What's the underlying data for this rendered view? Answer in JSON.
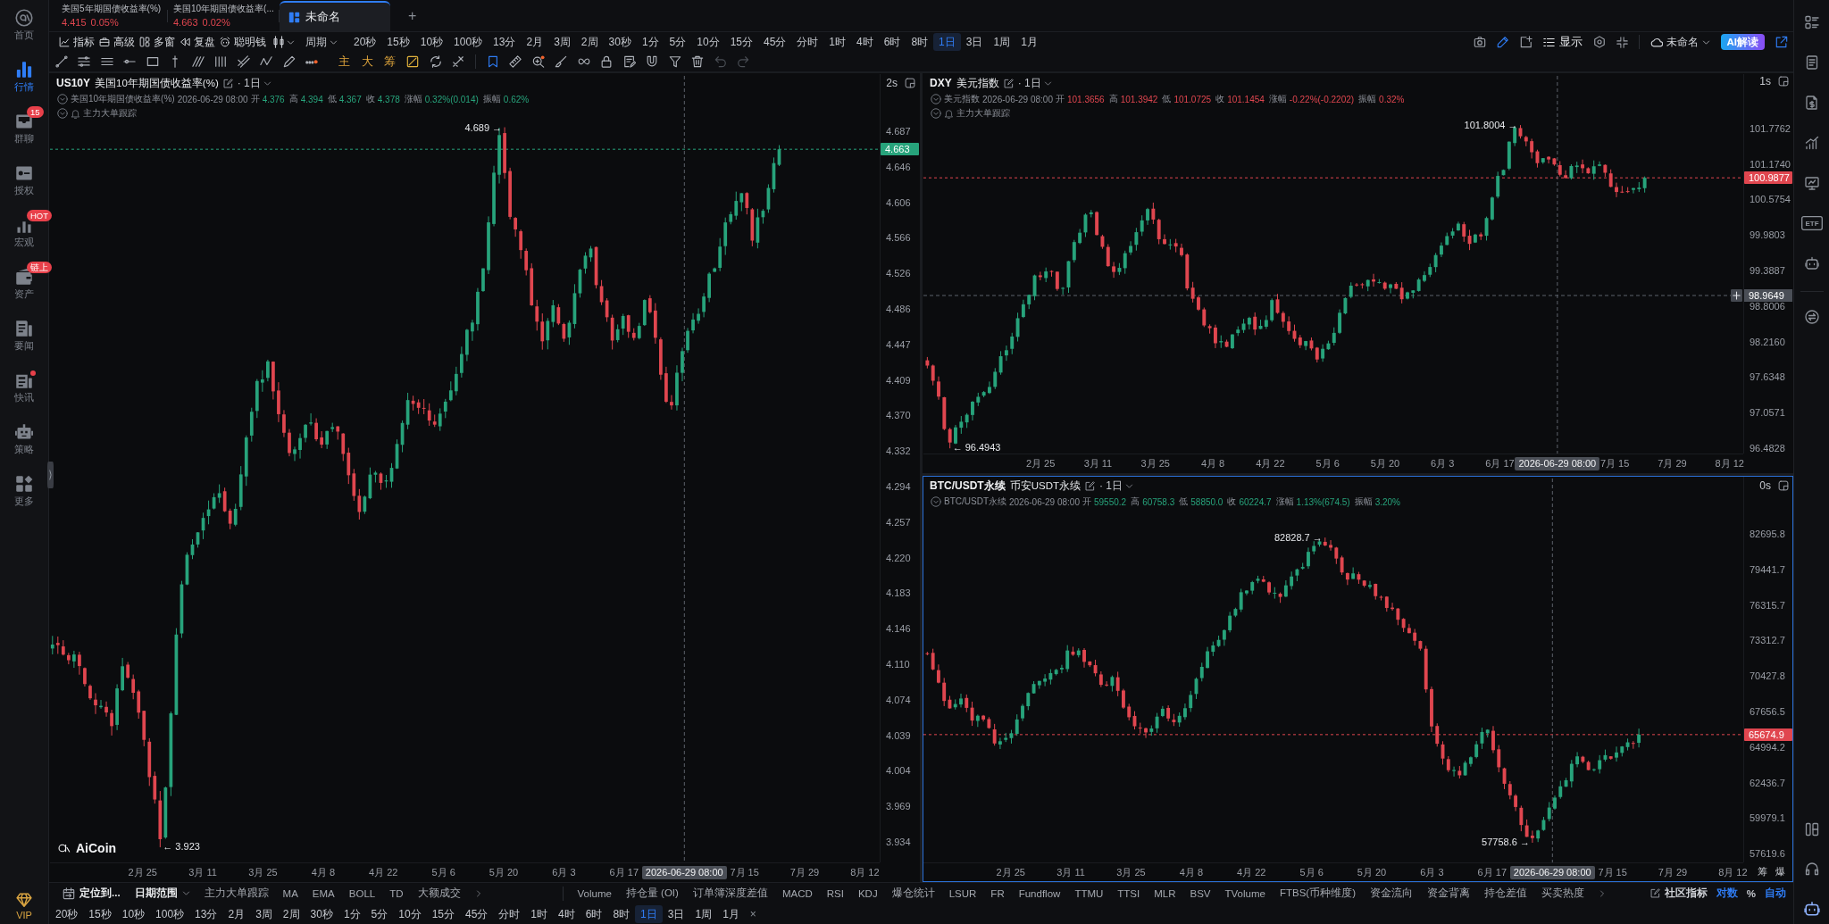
{
  "sidebar": {
    "items": [
      {
        "label": "首页",
        "selected": false,
        "dot": false
      },
      {
        "label": "行情",
        "selected": true,
        "dot": false
      },
      {
        "label": "群聊",
        "selected": false,
        "dot": false,
        "badge": "15"
      },
      {
        "label": "授权",
        "selected": false,
        "dot": false
      },
      {
        "label": "宏观",
        "selected": false,
        "dot": false,
        "badge": "HOT"
      },
      {
        "label": "资产",
        "selected": false,
        "dot": false,
        "badge": "链上"
      },
      {
        "label": "要闻",
        "selected": false,
        "dot": false
      },
      {
        "label": "快讯",
        "selected": false,
        "dot": true
      },
      {
        "label": "策略",
        "selected": false,
        "dot": false
      },
      {
        "label": "更多",
        "selected": false,
        "dot": false
      }
    ],
    "vip": "VIP"
  },
  "tabs": {
    "items": [
      {
        "kind": "quote",
        "title": "美国5年期国债收益率(%)",
        "price": "4.415",
        "change": "0.05%",
        "selected": false
      },
      {
        "kind": "quote",
        "title": "美国10年期国债收益率(...",
        "price": "4.663",
        "change": "0.02%",
        "selected": false
      },
      {
        "kind": "layout",
        "title": "未命名",
        "selected": true
      }
    ],
    "add": "+"
  },
  "toolbar": {
    "tools": [
      "指标",
      "高级",
      "多窗",
      "复盘",
      "聪明钱"
    ],
    "period": "周期",
    "intervals": [
      {
        "label": "20秒",
        "selected": false
      },
      {
        "label": "15秒",
        "selected": false
      },
      {
        "label": "10秒",
        "selected": false
      },
      {
        "label": "100秒",
        "selected": false
      },
      {
        "label": "13分",
        "selected": false
      },
      {
        "label": "2月",
        "selected": false
      },
      {
        "label": "3周",
        "selected": false
      },
      {
        "label": "2周",
        "selected": false
      },
      {
        "label": "30秒",
        "selected": false
      },
      {
        "label": "1分",
        "selected": false
      },
      {
        "label": "5分",
        "selected": false
      },
      {
        "label": "10分",
        "selected": false
      },
      {
        "label": "15分",
        "selected": false
      },
      {
        "label": "45分",
        "selected": false
      },
      {
        "label": "分时",
        "selected": false
      },
      {
        "label": "1时",
        "selected": false
      },
      {
        "label": "4时",
        "selected": false
      },
      {
        "label": "6时",
        "selected": false
      },
      {
        "label": "8时",
        "selected": false
      },
      {
        "label": "1日",
        "selected": true
      },
      {
        "label": "3日",
        "selected": false
      },
      {
        "label": "1周",
        "selected": false
      },
      {
        "label": "1月",
        "selected": false
      }
    ],
    "display": "显示",
    "layout": "未命名",
    "ai": "AI解读"
  },
  "drawing_tools": {
    "markers": [
      "主",
      "大",
      "筹"
    ]
  },
  "charts": [
    {
      "symbol": "US10Y",
      "name": "美国10年期国债收益率(%)",
      "interval": "· 1日",
      "latency": "2s",
      "selected": false,
      "info": {
        "name": "美国10年期国债收益率(%)",
        "time": "2026-06-29 08:00",
        "up": true,
        "fields": [
          {
            "label": "开",
            "value": "4.376"
          },
          {
            "label": "高",
            "value": "4.394"
          },
          {
            "label": "低",
            "value": "4.367"
          },
          {
            "label": "收",
            "value": "4.378"
          },
          {
            "label": "涨幅",
            "value": "0.32%(0.014)"
          },
          {
            "label": "振幅",
            "value": "0.62%"
          }
        ]
      },
      "overlay": "主力大单跟踪",
      "y_ticks": [
        "4.687",
        "4.646",
        "4.606",
        "4.566",
        "4.526",
        "4.486",
        "4.447",
        "4.409",
        "4.370",
        "4.332",
        "4.294",
        "4.257",
        "4.220",
        "4.183",
        "4.146",
        "4.110",
        "4.074",
        "4.039",
        "4.004",
        "3.969",
        "3.934"
      ],
      "x_ticks": [
        {
          "label": "2月 25",
          "kind": "tick"
        },
        {
          "label": "3月 11",
          "kind": "tick"
        },
        {
          "label": "3月 25",
          "kind": "tick"
        },
        {
          "label": "4月 8",
          "kind": "tick"
        },
        {
          "label": "4月 22",
          "kind": "tick"
        },
        {
          "label": "5月 6",
          "kind": "tick"
        },
        {
          "label": "5月 20",
          "kind": "tick"
        },
        {
          "label": "6月 3",
          "kind": "tick"
        },
        {
          "label": "6月 17",
          "kind": "tick"
        },
        {
          "label": "2026-06-29 08:00",
          "kind": "crosshair"
        },
        {
          "label": "7月 15",
          "kind": "tick"
        },
        {
          "label": "7月 29",
          "kind": "tick"
        },
        {
          "label": "8月 12",
          "kind": "tick"
        }
      ],
      "price": {
        "value": "4.663",
        "up": true
      },
      "high": "4.689 →",
      "low": "← 3.923",
      "logo": "AiCoin"
    },
    {
      "symbol": "DXY",
      "name": "美元指数",
      "interval": "· 1日",
      "latency": "1s",
      "selected": false,
      "info": {
        "name": "美元指数",
        "time": "2026-06-29 08:00",
        "up": false,
        "fields": [
          {
            "label": "开",
            "value": "101.3656"
          },
          {
            "label": "高",
            "value": "101.3942"
          },
          {
            "label": "低",
            "value": "101.0725"
          },
          {
            "label": "收",
            "value": "101.1454"
          },
          {
            "label": "涨幅",
            "value": "-0.22%(-0.2202)"
          },
          {
            "label": "振幅",
            "value": "0.32%"
          }
        ]
      },
      "overlay": "主力大单跟踪",
      "y_ticks": [
        "101.7762",
        "101.1740",
        "100.5754",
        "99.9803",
        "99.3887",
        "98.8006",
        "98.2160",
        "97.6348",
        "97.0571",
        "96.4828"
      ],
      "x_ticks": [
        {
          "label": "2月 25",
          "kind": "tick"
        },
        {
          "label": "3月 11",
          "kind": "tick"
        },
        {
          "label": "3月 25",
          "kind": "tick"
        },
        {
          "label": "4月 8",
          "kind": "tick"
        },
        {
          "label": "4月 22",
          "kind": "tick"
        },
        {
          "label": "5月 6",
          "kind": "tick"
        },
        {
          "label": "5月 20",
          "kind": "tick"
        },
        {
          "label": "6月 3",
          "kind": "tick"
        },
        {
          "label": "6月 17",
          "kind": "tick"
        },
        {
          "label": "2026-06-29 08:00",
          "kind": "crosshair"
        },
        {
          "label": "7月 15",
          "kind": "tick"
        },
        {
          "label": "7月 29",
          "kind": "tick"
        },
        {
          "label": "8月 12",
          "kind": "tick"
        }
      ],
      "price": {
        "value": "100.9877",
        "up": false
      },
      "crosshair_price": "98.9649",
      "high": "101.8004 →",
      "low": "← 96.4943"
    },
    {
      "symbol": "BTC/USDT永续",
      "name": "币安USDT永续",
      "interval": "· 1日",
      "latency": "0s",
      "selected": true,
      "info": {
        "name": "BTC/USDT永续",
        "time": "2026-06-29 08:00",
        "up": true,
        "fields": [
          {
            "label": "开",
            "value": "59550.2"
          },
          {
            "label": "高",
            "value": "60758.3"
          },
          {
            "label": "低",
            "value": "58850.0"
          },
          {
            "label": "收",
            "value": "60224.7"
          },
          {
            "label": "涨幅",
            "value": "1.13%(674.5)"
          },
          {
            "label": "振幅",
            "value": "3.20%"
          }
        ]
      },
      "y_ticks": [
        "82695.8",
        "79441.7",
        "76315.7",
        "73312.7",
        "70427.8",
        "67656.5",
        "64994.2",
        "62436.7",
        "59979.1",
        "57619.6"
      ],
      "x_ticks": [
        {
          "label": "2月 25",
          "kind": "tick"
        },
        {
          "label": "3月 11",
          "kind": "tick"
        },
        {
          "label": "3月 25",
          "kind": "tick"
        },
        {
          "label": "4月 8",
          "kind": "tick"
        },
        {
          "label": "4月 22",
          "kind": "tick"
        },
        {
          "label": "5月 6",
          "kind": "tick"
        },
        {
          "label": "5月 20",
          "kind": "tick"
        },
        {
          "label": "6月 3",
          "kind": "tick"
        },
        {
          "label": "6月 17",
          "kind": "tick"
        },
        {
          "label": "2026-06-29 08:00",
          "kind": "crosshair"
        },
        {
          "label": "7月 15",
          "kind": "tick"
        },
        {
          "label": "7月 29",
          "kind": "tick"
        },
        {
          "label": "8月 12",
          "kind": "tick"
        }
      ],
      "price": {
        "value": "65674.9",
        "up": false
      },
      "high": "82828.7 →",
      "low": "57758.6 →",
      "axis_buttons": [
        "筹",
        "爆"
      ]
    }
  ],
  "bottom_bar": {
    "locate": "定位到...",
    "date_range": "日期范围",
    "main_indicators": [
      "主力大单跟踪",
      "MA",
      "EMA",
      "BOLL",
      "TD",
      "大额成交"
    ],
    "sub_indicators": [
      "Volume",
      "持仓量 (OI)",
      "订单簿深度差值",
      "MACD",
      "RSI",
      "KDJ",
      "爆仓统计",
      "LSUR",
      "FR",
      "Fundflow",
      "TTMU",
      "TTSI",
      "MLR",
      "BSV",
      "TVolume",
      "FTBS(币种维度)",
      "资金流向",
      "资金背离",
      "持仓差值",
      "买卖热度"
    ],
    "community": "社区指标",
    "scales": [
      {
        "label": "对数",
        "selected": true
      },
      {
        "label": "%",
        "selected": false
      },
      {
        "label": "自动",
        "selected": true
      }
    ]
  },
  "bottom_intervals": {
    "items": [
      {
        "label": "20秒",
        "selected": false
      },
      {
        "label": "15秒",
        "selected": false
      },
      {
        "label": "10秒",
        "selected": false
      },
      {
        "label": "100秒",
        "selected": false
      },
      {
        "label": "13分",
        "selected": false
      },
      {
        "label": "2月",
        "selected": false
      },
      {
        "label": "3周",
        "selected": false
      },
      {
        "label": "2周",
        "selected": false
      },
      {
        "label": "30秒",
        "selected": false
      },
      {
        "label": "1分",
        "selected": false
      },
      {
        "label": "5分",
        "selected": false
      },
      {
        "label": "10分",
        "selected": false
      },
      {
        "label": "15分",
        "selected": false
      },
      {
        "label": "45分",
        "selected": false
      },
      {
        "label": "分时",
        "selected": false
      },
      {
        "label": "1时",
        "selected": false
      },
      {
        "label": "4时",
        "selected": false
      },
      {
        "label": "6时",
        "selected": false
      },
      {
        "label": "8时",
        "selected": false
      },
      {
        "label": "1日",
        "selected": true
      },
      {
        "label": "3日",
        "selected": false
      },
      {
        "label": "1周",
        "selected": false
      },
      {
        "label": "1月",
        "selected": false
      }
    ],
    "close": "×"
  },
  "right_sidebar": {
    "etf": "ETF"
  }
}
